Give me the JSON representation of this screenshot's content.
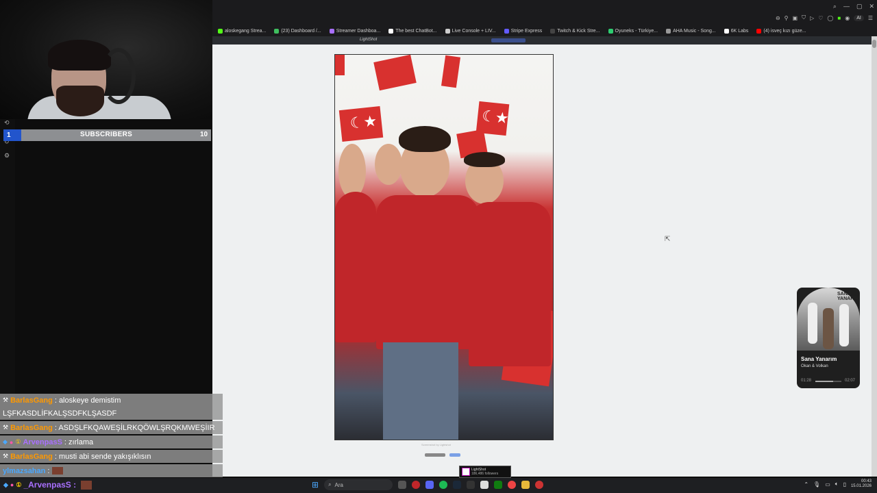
{
  "browser": {
    "bookmarks": [
      {
        "label": "aloskegang Strea...",
        "color": "#53fc18"
      },
      {
        "label": "(23) Dashboard /...",
        "color": "#3fbf5f"
      },
      {
        "label": "Streamer Dashboa...",
        "color": "#a970ff"
      },
      {
        "label": "The best ChatBot...",
        "color": "#ffffff"
      },
      {
        "label": "Live Console + LIV...",
        "color": "#cccccc"
      },
      {
        "label": "Stripe Express",
        "color": "#635bff"
      },
      {
        "label": "Twitch & Kick Stre...",
        "color": "#444444"
      },
      {
        "label": "Oyuneks - Türkiye...",
        "color": "#2ecc71"
      },
      {
        "label": "AHA Music - Song...",
        "color": "#999999"
      },
      {
        "label": "6K Labs",
        "color": "#ffffff"
      },
      {
        "label": "(4) isveç kızı güze...",
        "color": "#ff0000"
      }
    ],
    "window_controls": [
      "search-icon",
      "minimize-icon",
      "maximize-icon",
      "close-icon"
    ],
    "toolbar_ai_label": "AI"
  },
  "lightshot": {
    "logo": "LightShot",
    "caption": "Screenshot by Lightshot",
    "thumb_title": "LightShot",
    "thumb_sub": "186,486 followers"
  },
  "overlay": {
    "subscribers": {
      "current": "1",
      "label": "SUBSCRIBERS",
      "target": "10"
    },
    "chat": [
      {
        "user": "BarlasGang",
        "text": ": aloskeye demistim",
        "user_color": "orange"
      },
      {
        "user": "",
        "text": "LŞFKASDLİFKALŞSDFKLŞASDF",
        "user_color": "orange"
      },
      {
        "user": "BarlasGang",
        "text": ": ASDŞLFKQAWEŞİLRKQÖWLŞRQKMWEŞİIR",
        "user_color": "orange"
      },
      {
        "user": "ArvenpasS",
        "text": ": zırlama",
        "user_color": "purple"
      },
      {
        "user": "BarlasGang",
        "text": ": musti abi sende yakışıklısın",
        "user_color": "orange"
      },
      {
        "user": "ylmazsahan",
        "text": ":",
        "user_color": "blue"
      }
    ],
    "bottom_user": "_ArvenpasS :"
  },
  "music": {
    "title": "Sana Yanarım",
    "artist": "Okan & Volkan",
    "current_time": "01:28",
    "total_time": "02:07",
    "progress": 0.69,
    "art_text": "SANA YANARIM"
  },
  "taskbar": {
    "search_placeholder": "Ara",
    "time": "00:43",
    "date": "15.01.2026"
  }
}
